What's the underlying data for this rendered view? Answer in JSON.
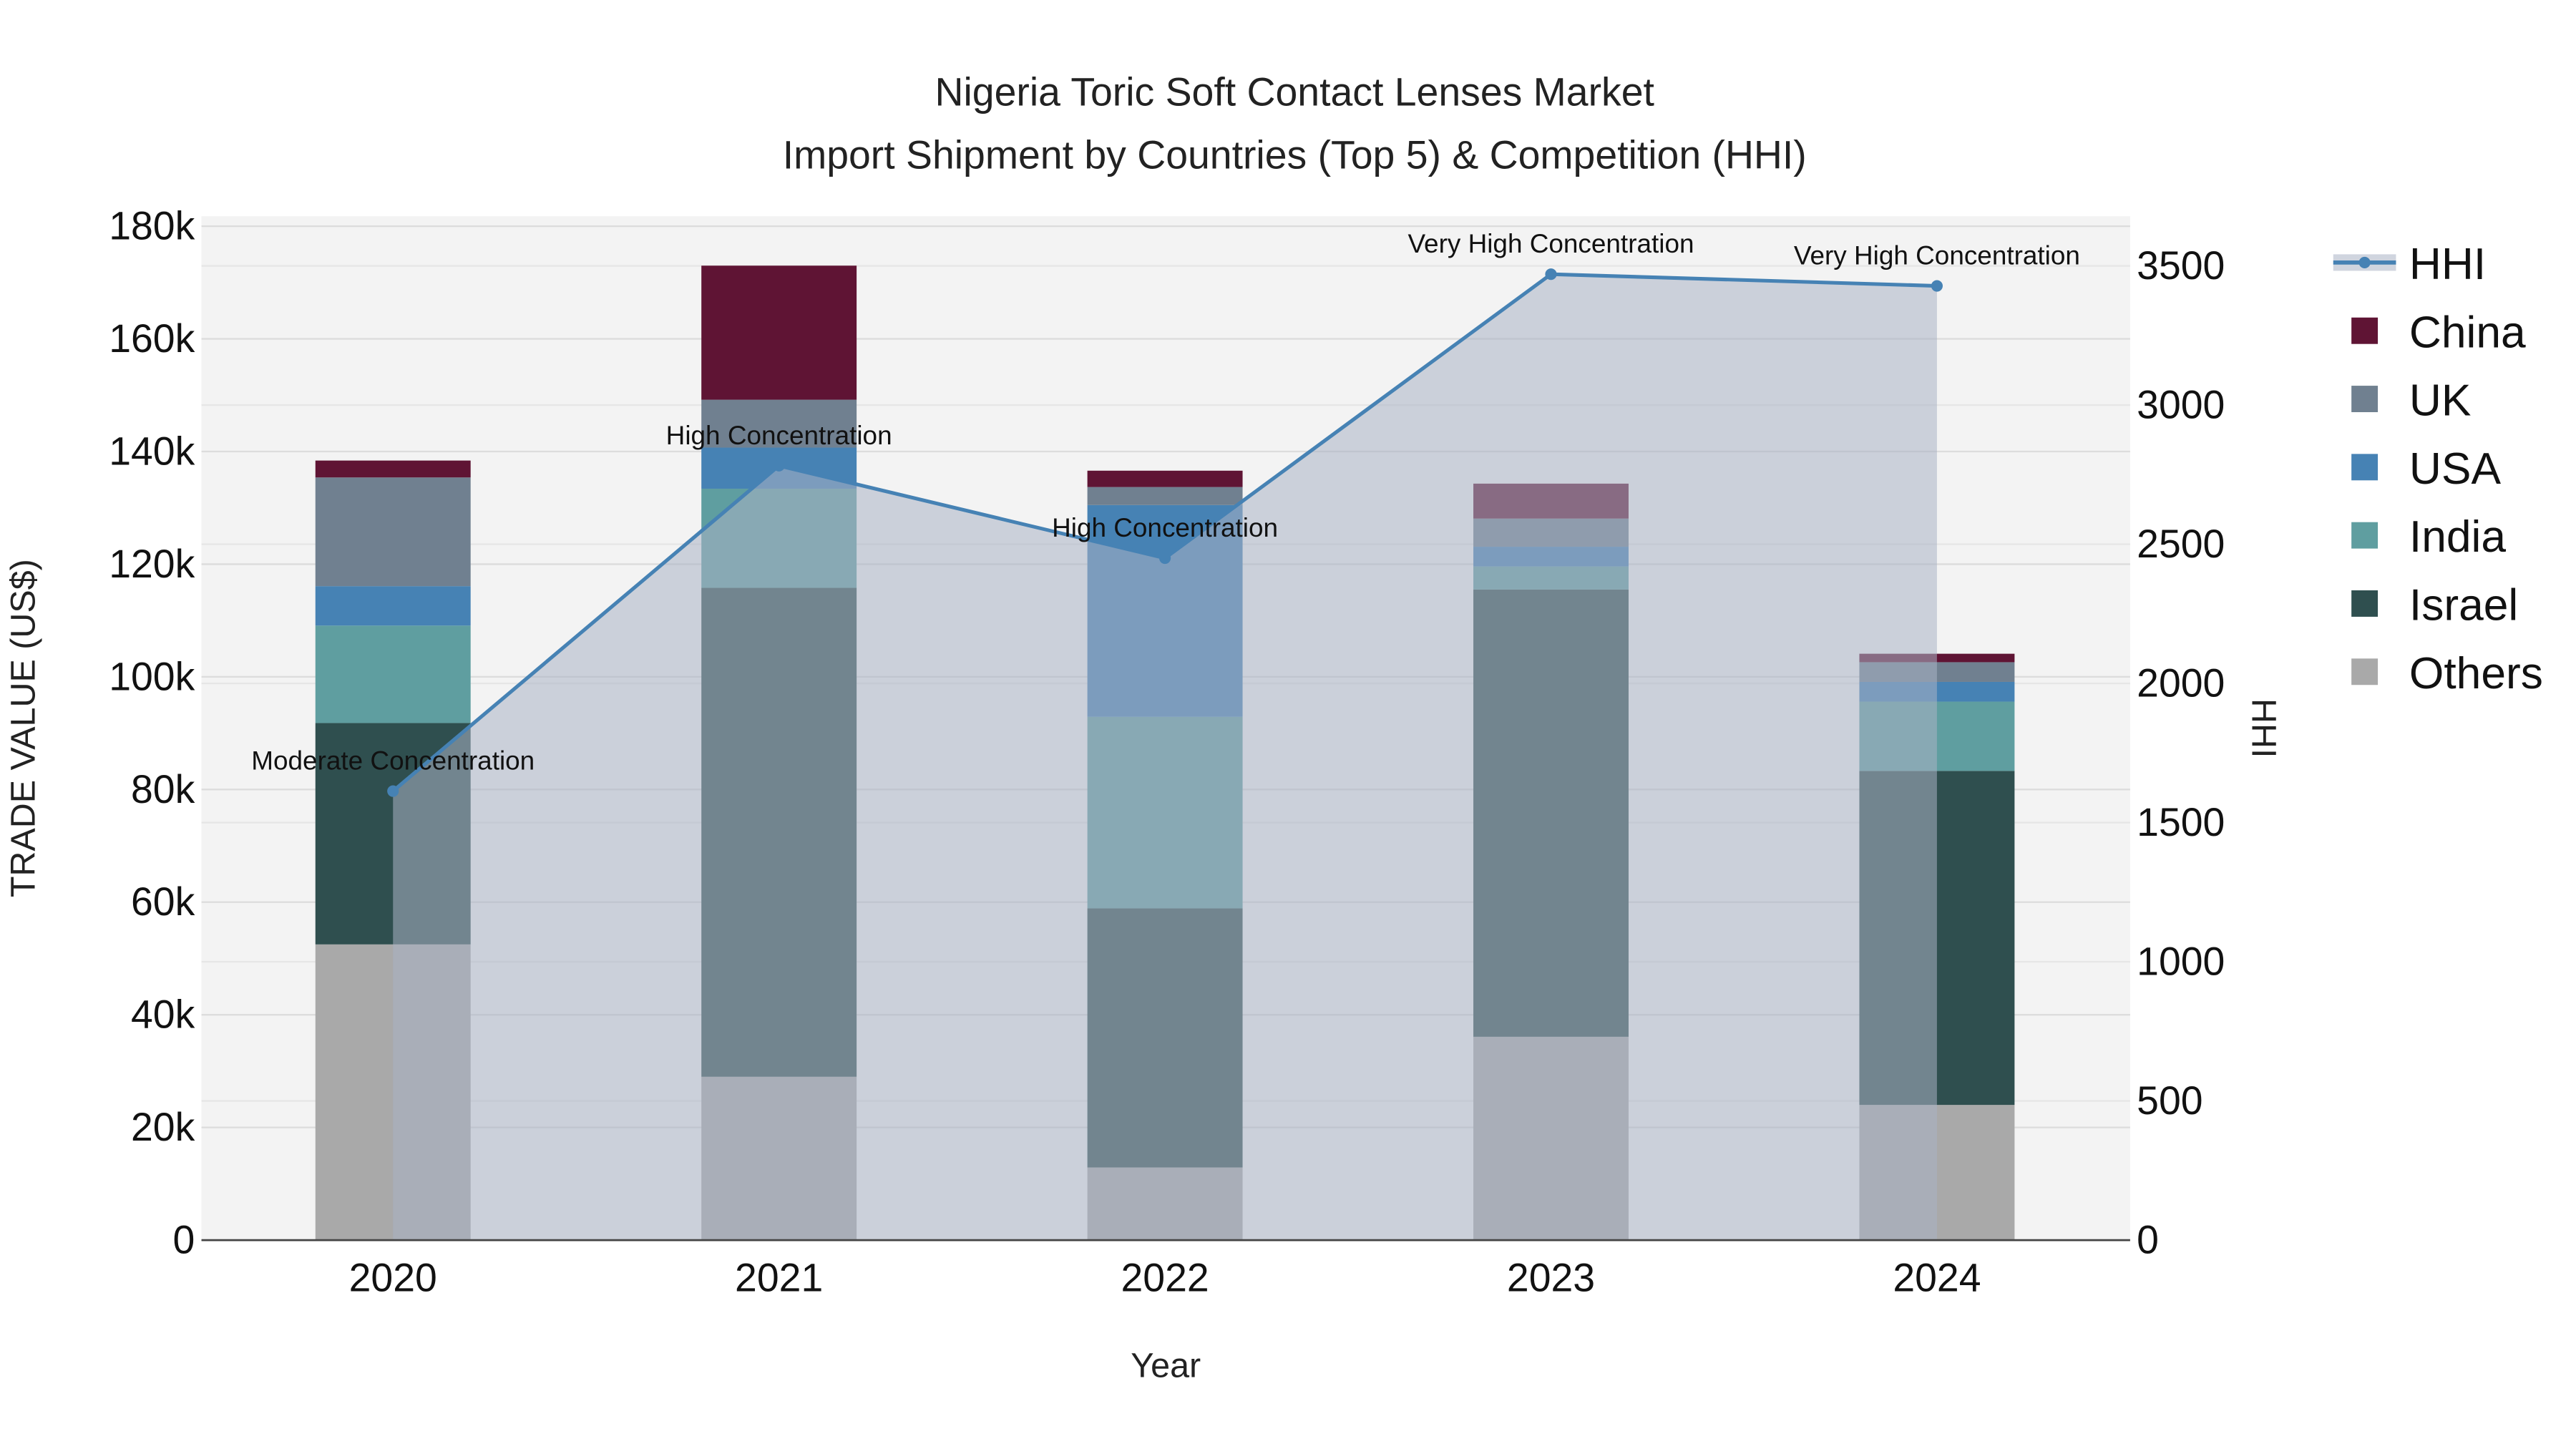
{
  "chart_data": {
    "type": "bar",
    "stacked": true,
    "title": "Nigeria Toric Soft Contact Lenses Market",
    "subtitle": "Import Shipment by Countries (Top 5) & Competition (HHI)",
    "xlabel": "Year",
    "ylabel": "TRADE VALUE (US$)",
    "y2label": "HHI",
    "categories": [
      "2020",
      "2021",
      "2022",
      "2023",
      "2024"
    ],
    "ylim": [
      0,
      180000
    ],
    "y2lim": [
      0,
      3675
    ],
    "yticks": [
      "0",
      "20k",
      "40k",
      "60k",
      "80k",
      "100k",
      "120k",
      "140k",
      "160k",
      "180k"
    ],
    "y2ticks": [
      "0",
      "500",
      "1000",
      "1500",
      "2000",
      "2500",
      "3000",
      "3500"
    ],
    "series": [
      {
        "name": "Others",
        "color": "#a9a9a9",
        "values": [
          52500,
          29000,
          12900,
          36100,
          24000
        ]
      },
      {
        "name": "Israel",
        "color": "#2f4f4f",
        "values": [
          39300,
          86800,
          46000,
          79400,
          59300
        ]
      },
      {
        "name": "India",
        "color": "#5f9ea0",
        "values": [
          17300,
          17600,
          34000,
          4100,
          12300
        ]
      },
      {
        "name": "USA",
        "color": "#4682b4",
        "values": [
          7000,
          7300,
          37600,
          3500,
          3500
        ]
      },
      {
        "name": "UK",
        "color": "#708090",
        "values": [
          19300,
          8500,
          3200,
          5000,
          3500
        ]
      },
      {
        "name": "China",
        "color": "#5f1434",
        "values": [
          3000,
          23800,
          2900,
          6200,
          1500
        ]
      }
    ],
    "hhi": {
      "name": "HHI",
      "color": "#4682b4",
      "values": [
        1613,
        2782,
        2450,
        3470,
        3428
      ],
      "annotations": [
        "Moderate Concentration",
        "High Concentration",
        "High Concentration",
        "Very High Concentration",
        "Very High Concentration"
      ]
    },
    "legend": [
      "HHI",
      "China",
      "UK",
      "USA",
      "India",
      "Israel",
      "Others"
    ],
    "legend_position": "right",
    "grid": true
  }
}
